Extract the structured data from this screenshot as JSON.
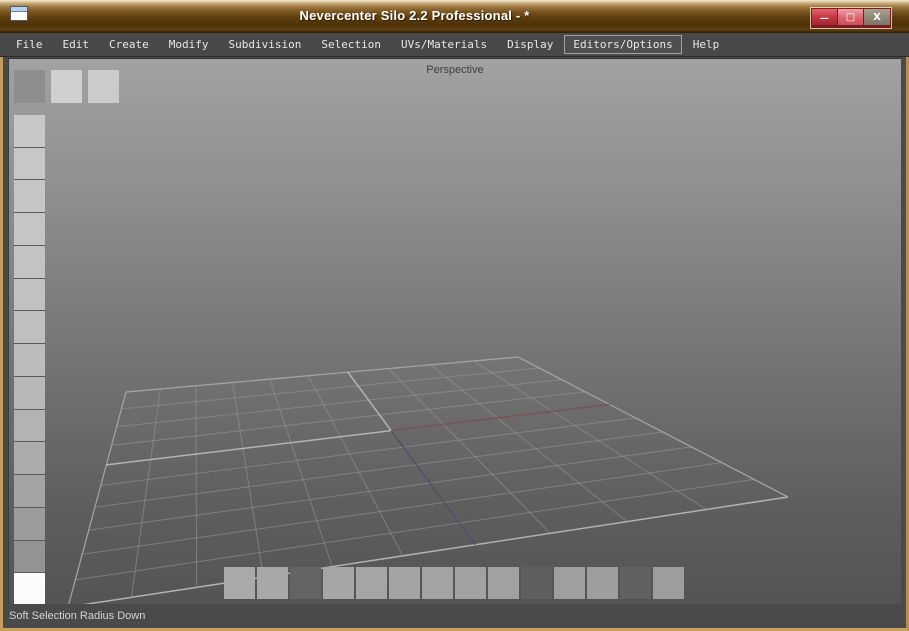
{
  "window": {
    "title": "Nevercenter Silo 2.2 Professional - *",
    "controls": [
      {
        "id": "minimize",
        "glyph": "—"
      },
      {
        "id": "maximize",
        "glyph": "□"
      },
      {
        "id": "close",
        "glyph": "X"
      }
    ]
  },
  "menubar": {
    "items": [
      {
        "label": "File",
        "active": false
      },
      {
        "label": "Edit",
        "active": false
      },
      {
        "label": "Create",
        "active": false
      },
      {
        "label": "Modify",
        "active": false
      },
      {
        "label": "Subdivision",
        "active": false
      },
      {
        "label": "Selection",
        "active": false
      },
      {
        "label": "UVs/Materials",
        "active": false
      },
      {
        "label": "Display",
        "active": false
      },
      {
        "label": "Editors/Options",
        "active": true
      },
      {
        "label": "Help",
        "active": false
      }
    ]
  },
  "viewport": {
    "label": "Perspective"
  },
  "statusbar": {
    "text": "Soft Selection Radius Down"
  },
  "toolbars": {
    "top": {
      "buttons": [
        {
          "state": "pressed",
          "shade": "#8e8e8e"
        },
        {
          "state": "normal",
          "shade": "#d0d0d0"
        },
        {
          "state": "normal",
          "shade": "#cbcbcb"
        }
      ]
    },
    "left": {
      "buttons": [
        {
          "state": "normal",
          "shade": "#c8c8c8"
        },
        {
          "state": "normal",
          "shade": "#c7c7c7"
        },
        {
          "state": "normal",
          "shade": "#c6c6c6"
        },
        {
          "state": "normal",
          "shade": "#c5c5c5"
        },
        {
          "state": "normal",
          "shade": "#c3c3c3"
        },
        {
          "state": "normal",
          "shade": "#c1c1c1"
        },
        {
          "state": "normal",
          "shade": "#bfbfbf"
        },
        {
          "state": "normal",
          "shade": "#bcbcbc"
        },
        {
          "state": "normal",
          "shade": "#b8b8b8"
        },
        {
          "state": "normal",
          "shade": "#b3b3b3"
        },
        {
          "state": "normal",
          "shade": "#acacac"
        },
        {
          "state": "normal",
          "shade": "#a4a4a4"
        },
        {
          "state": "normal",
          "shade": "#9c9c9c"
        },
        {
          "state": "normal",
          "shade": "#939393"
        },
        {
          "state": "highlighted",
          "shade": "#fbfbfb"
        }
      ]
    },
    "bottom": {
      "buttons": [
        {
          "state": "normal",
          "shade": "#a9a9a9"
        },
        {
          "state": "normal",
          "shade": "#a8a8a8"
        },
        {
          "state": "dark",
          "shade": "#646464"
        },
        {
          "state": "normal",
          "shade": "#a6a6a6"
        },
        {
          "state": "normal",
          "shade": "#a5a5a5"
        },
        {
          "state": "normal",
          "shade": "#a4a4a4"
        },
        {
          "state": "normal",
          "shade": "#a3a3a3"
        },
        {
          "state": "normal",
          "shade": "#a2a2a2"
        },
        {
          "state": "normal",
          "shade": "#a1a1a1"
        },
        {
          "state": "dark",
          "shade": "#5f5f5f"
        },
        {
          "state": "normal",
          "shade": "#9f9f9f"
        },
        {
          "state": "normal",
          "shade": "#9e9e9e"
        },
        {
          "state": "dark",
          "shade": "#616161"
        },
        {
          "state": "normal",
          "shade": "#9d9d9d"
        }
      ]
    }
  },
  "colors": {
    "x_axis": "#7a5252",
    "z_axis": "#515164",
    "grid_line": "#9a9a9a",
    "grid_edge": "#a8a8a8",
    "grid_bottom_edge": "#b6b6b6",
    "grid_axis_bright": "#b8b8b8",
    "titlebar_accent": "#6f4c16",
    "menubar_bg": "#494949",
    "close_button": "#8d8574",
    "minimize_button": "#c23542"
  }
}
